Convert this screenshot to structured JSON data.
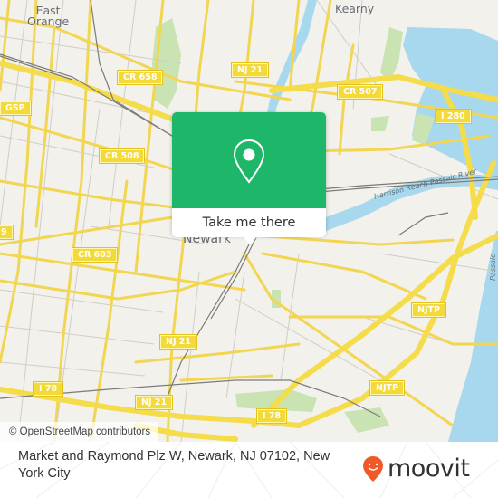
{
  "map": {
    "places": [
      {
        "name": "East Orange",
        "lines": [
          "East",
          "Orange"
        ]
      },
      {
        "name": "Kearny",
        "lines": [
          "Kearny"
        ]
      },
      {
        "name": "Newark",
        "lines": [
          "Newark"
        ]
      }
    ],
    "road_shields": [
      "CR 658",
      "NJ 21",
      "CR 507",
      "I 280",
      "CR 508",
      "GSP",
      "CR 603",
      "NJTP",
      "NJ 21",
      "NJ 21",
      "NJTP",
      "I 78",
      "I 78",
      "9"
    ],
    "river_labels": [
      "Harrison Reach Passaic River",
      "Passaic"
    ],
    "colors": {
      "land": "#f2f1ec",
      "water": "#a8d8ee",
      "park": "#c9e3b2",
      "road": "#f7e37a",
      "road_casing": "#e8cc3a",
      "minor_road": "#c8c6c0",
      "rail": "#777777"
    }
  },
  "attribution": "© OpenStreetMap contributors",
  "popup": {
    "icon": "map-pin-icon",
    "button_label": "Take me there",
    "accent": "#1eb76a"
  },
  "footer": {
    "address": "Market and Raymond Plz W, Newark, NJ 07102, New York City",
    "brand": "moovit",
    "brand_color": "#f05a28"
  }
}
